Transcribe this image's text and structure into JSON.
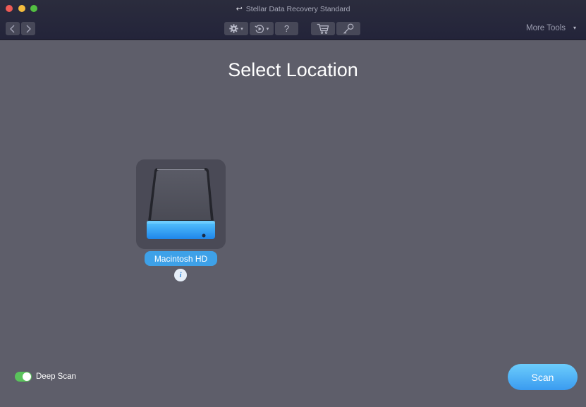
{
  "window": {
    "title": "Stellar Data Recovery Standard",
    "title_icon": "undo-arrow-icon"
  },
  "toolbar": {
    "back_icon": "chevron-left-icon",
    "forward_icon": "chevron-right-icon",
    "settings_icon": "gear-icon",
    "history_icon": "history-play-icon",
    "help_label": "?",
    "cart_icon": "cart-icon",
    "key_icon": "key-icon",
    "more_tools_label": "More Tools",
    "dropdown_caret": "▾"
  },
  "main": {
    "heading": "Select Location",
    "drives": [
      {
        "label": "Macintosh HD",
        "icon": "hard-drive-icon",
        "info_label": "i"
      }
    ]
  },
  "footer": {
    "deep_scan_label": "Deep Scan",
    "deep_scan_enabled": true,
    "scan_label": "Scan"
  },
  "colors": {
    "accent": "#3ea1e8",
    "toggle_on": "#5ac35b",
    "background": "#5e5e6a",
    "titlebar": "#26273a"
  }
}
